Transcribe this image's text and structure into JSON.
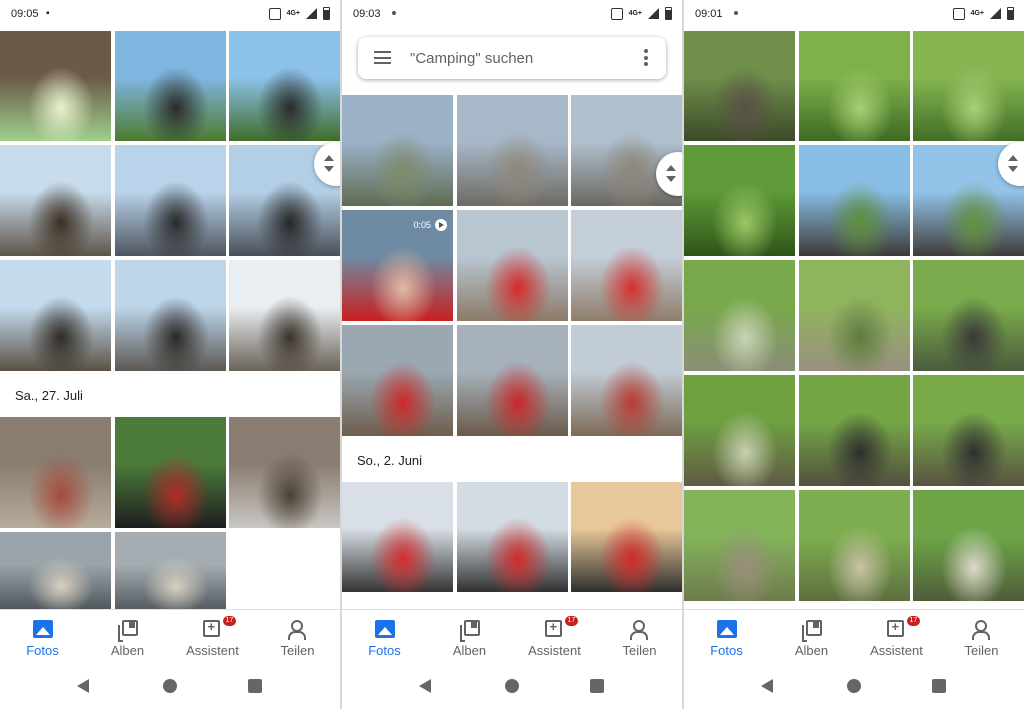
{
  "screens": [
    {
      "status": {
        "time": "09:05",
        "network": "4G+"
      },
      "date_labels": [
        "Sa., 27. Juli"
      ],
      "tiles": [
        {
          "name": "photo-ice-cream",
          "c1": "#6b5a4a",
          "c2": "#9fd08a",
          "accent": "#e9f2d0"
        },
        {
          "name": "photo-bike-hill",
          "c1": "#7fb6e0",
          "c2": "#4d7a2f",
          "accent": "#2c2c2c"
        },
        {
          "name": "photo-bike-valley",
          "c1": "#8cc2ea",
          "c2": "#3f6c28",
          "accent": "#2b2b2b"
        },
        {
          "name": "photo-cross-sea-1",
          "c1": "#c8dcec",
          "c2": "#5d5447",
          "accent": "#3a2e22"
        },
        {
          "name": "photo-cross-sea-2",
          "c1": "#b9d4ea",
          "c2": "#4f5460",
          "accent": "#2a2a2a"
        },
        {
          "name": "photo-cross-sea-3",
          "c1": "#b3cfe6",
          "c2": "#4a4f58",
          "accent": "#262626"
        },
        {
          "name": "photo-cross-sea-4",
          "c1": "#c4dbed",
          "c2": "#5a5145",
          "accent": "#2f2a24"
        },
        {
          "name": "photo-cross-sea-5",
          "c1": "#bdd6ea",
          "c2": "#5b5750",
          "accent": "#2c2826"
        },
        {
          "name": "photo-cross-sea-6",
          "c1": "#e9eef2",
          "c2": "#6a6257",
          "accent": "#3a332b"
        },
        {
          "name": "photo-ground-stairs",
          "c1": "#8a7d70",
          "c2": "#b9ab9a",
          "accent": "#a54a3c"
        },
        {
          "name": "photo-bike-bag",
          "c1": "#4c7a3a",
          "c2": "#1e1e1e",
          "accent": "#b22a2a"
        },
        {
          "name": "photo-sign-plate",
          "c1": "#8a7c70",
          "c2": "#c9c7c3",
          "accent": "#4a4035"
        },
        {
          "name": "photo-device-1",
          "c1": "#9aa4aa",
          "c2": "#4f585e",
          "accent": "#d8d0c0"
        },
        {
          "name": "photo-device-2",
          "c1": "#a5adb2",
          "c2": "#555d62",
          "accent": "#d6cfbf"
        }
      ]
    },
    {
      "status": {
        "time": "09:03",
        "network": "4G+"
      },
      "search_placeholder": "\"Camping\" suchen",
      "date_labels": [
        "So., 2. Juni"
      ],
      "video_duration": "0:05",
      "tiles": [
        {
          "name": "photo-sea-view-1",
          "c1": "#9cb2c8",
          "c2": "#5f6b52",
          "accent": "#7d8a6a"
        },
        {
          "name": "photo-sea-view-2",
          "c1": "#a7b8c8",
          "c2": "#6e6a62",
          "accent": "#8f877a"
        },
        {
          "name": "photo-sea-view-3",
          "c1": "#b0c0cf",
          "c2": "#6c6860",
          "accent": "#8d8578"
        },
        {
          "name": "video-selfie",
          "c1": "#6f8aa3",
          "c2": "#c9201f",
          "accent": "#e2b9a4"
        },
        {
          "name": "photo-tent-village-1",
          "c1": "#b8c6d2",
          "c2": "#8c7a66",
          "accent": "#d42a2a"
        },
        {
          "name": "photo-tent-village-2",
          "c1": "#c3ced8",
          "c2": "#8f7d69",
          "accent": "#d63030"
        },
        {
          "name": "photo-tent-village-3",
          "c1": "#9ba8b2",
          "c2": "#6e5d4b",
          "accent": "#cc2929"
        },
        {
          "name": "photo-tent-village-4",
          "c1": "#a6b1bb",
          "c2": "#6b5a49",
          "accent": "#c92828"
        },
        {
          "name": "photo-village-square",
          "c1": "#c1ccd6",
          "c2": "#7d6a56",
          "accent": "#b83a30"
        },
        {
          "name": "photo-cyclist-1",
          "c1": "#d8dfe6",
          "c2": "#333333",
          "accent": "#d42c2c"
        },
        {
          "name": "photo-cyclist-2",
          "c1": "#d3dbe3",
          "c2": "#303030",
          "accent": "#d02a2a"
        },
        {
          "name": "photo-cyclist-sunset",
          "c1": "#e8c79a",
          "c2": "#2e2e2e",
          "accent": "#cf2a2a"
        }
      ]
    },
    {
      "status": {
        "time": "09:01",
        "network": "4G+"
      },
      "tiles": [
        {
          "name": "photo-ruin-tower",
          "c1": "#6f8f4a",
          "c2": "#3c4a2a",
          "accent": "#5a5047"
        },
        {
          "name": "photo-forest-1",
          "c1": "#7fb04c",
          "c2": "#3d6a22",
          "accent": "#a7cf72"
        },
        {
          "name": "photo-forest-2",
          "c1": "#86b552",
          "c2": "#426e25",
          "accent": "#a9d076"
        },
        {
          "name": "photo-forest-3",
          "c1": "#5e9a38",
          "c2": "#2f5418",
          "accent": "#9cc766"
        },
        {
          "name": "photo-window-view-1",
          "c1": "#88bde5",
          "c2": "#3d3a36",
          "accent": "#5e8f3a"
        },
        {
          "name": "photo-window-view-2",
          "c1": "#92c3e8",
          "c2": "#3f3b37",
          "accent": "#62923c"
        },
        {
          "name": "photo-forest-path-1",
          "c1": "#78a84a",
          "c2": "#8a8f78",
          "accent": "#c9d4b6"
        },
        {
          "name": "photo-ruin-arch",
          "c1": "#8fb45e",
          "c2": "#9a8f80",
          "accent": "#5e7d3e"
        },
        {
          "name": "photo-hiker-back",
          "c1": "#7aab4c",
          "c2": "#4b5a3c",
          "accent": "#3a3a3a"
        },
        {
          "name": "photo-forest-path-2",
          "c1": "#6ea040",
          "c2": "#5f5a44",
          "accent": "#c8d0b2"
        },
        {
          "name": "photo-hikers-path-1",
          "c1": "#74a646",
          "c2": "#53503f",
          "accent": "#2f2f2f"
        },
        {
          "name": "photo-hikers-path-2",
          "c1": "#79aa4a",
          "c2": "#575341",
          "accent": "#303030"
        },
        {
          "name": "photo-ruin-wall",
          "c1": "#84b35a",
          "c2": "#6e7a4e",
          "accent": "#9a8e7e"
        },
        {
          "name": "photo-hiker-trail",
          "c1": "#7eae50",
          "c2": "#5e6e40",
          "accent": "#c9c2a6"
        },
        {
          "name": "photo-hikers-stairs",
          "c1": "#6da447",
          "c2": "#4f5c3a",
          "accent": "#dcd9cc"
        }
      ]
    }
  ],
  "bottom_nav": [
    {
      "label": "Fotos",
      "icon": "photos-icon",
      "active": true
    },
    {
      "label": "Alben",
      "icon": "albums-icon"
    },
    {
      "label": "Assistent",
      "icon": "assistant-icon",
      "badge": "17"
    },
    {
      "label": "Teilen",
      "icon": "share-icon"
    }
  ],
  "colors": {
    "accent": "#1a73e8",
    "badge": "#c5221f",
    "text": "#202124"
  }
}
